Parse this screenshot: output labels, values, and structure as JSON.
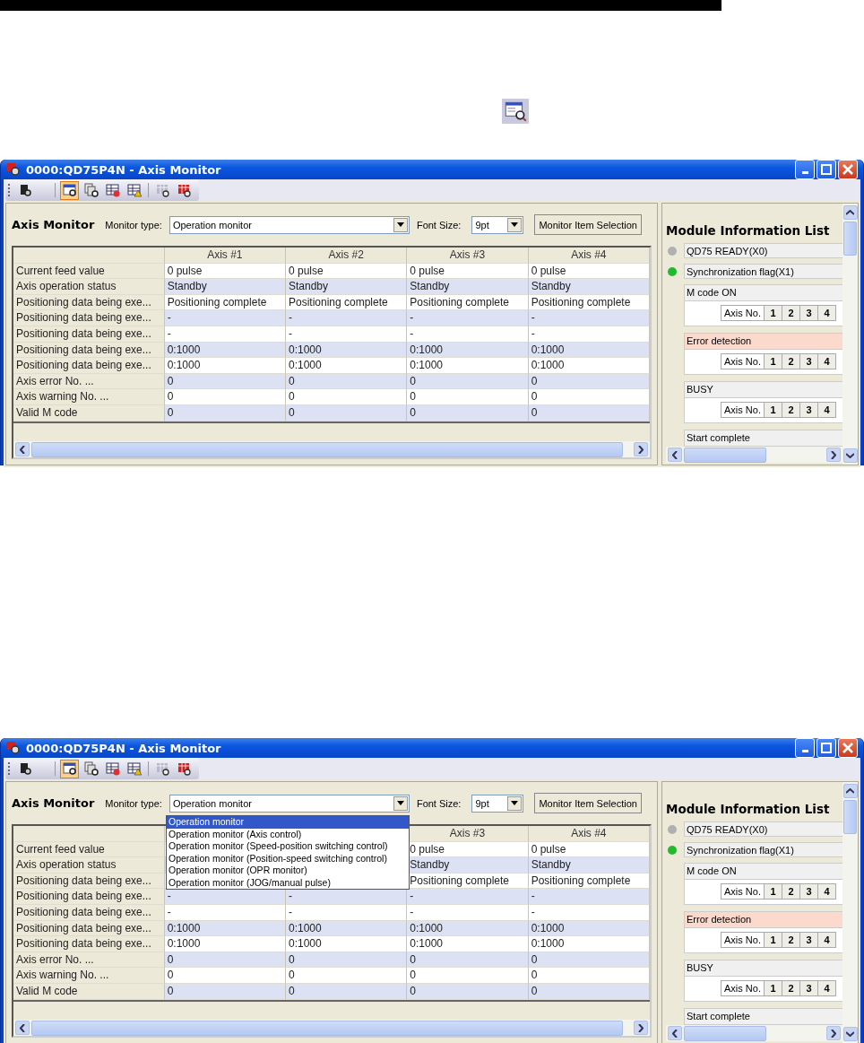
{
  "windows": [
    {
      "title": "0000:QD75P4N - Axis Monitor",
      "toolbar": [
        {
          "selected": false
        },
        {
          "selected": true
        },
        {
          "selected": false
        },
        {
          "selected": false
        },
        {
          "selected": false
        },
        {
          "selected": false
        },
        {
          "selected": false
        }
      ],
      "monitor": {
        "title": "Axis Monitor",
        "type_label": "Monitor type:",
        "type_value": "Operation monitor",
        "font_label": "Font Size:",
        "font_value": "9pt",
        "button": "Monitor Item Selection"
      },
      "table": {
        "columns": [
          "Axis #1",
          "Axis #2",
          "Axis #3",
          "Axis #4"
        ],
        "rows": [
          {
            "label": "Current feed value",
            "cells": [
              "0 pulse",
              "0 pulse",
              "0 pulse",
              "0 pulse"
            ]
          },
          {
            "label": "Axis operation status",
            "cells": [
              "Standby",
              "Standby",
              "Standby",
              "Standby"
            ]
          },
          {
            "label": "Positioning data being exe...",
            "cells": [
              "Positioning complete",
              "Positioning complete",
              "Positioning complete",
              "Positioning complete"
            ]
          },
          {
            "label": "Positioning data being exe...",
            "cells": [
              "-",
              "-",
              "-",
              "-"
            ]
          },
          {
            "label": "Positioning data being exe...",
            "cells": [
              "-",
              "-",
              "-",
              "-"
            ]
          },
          {
            "label": "Positioning data being exe...",
            "cells": [
              "0:1000",
              "0:1000",
              "0:1000",
              "0:1000"
            ]
          },
          {
            "label": "Positioning data being exe...",
            "cells": [
              "0:1000",
              "0:1000",
              "0:1000",
              "0:1000"
            ]
          },
          {
            "label": "Axis error No. ...",
            "cells": [
              "0",
              "0",
              "0",
              "0"
            ]
          },
          {
            "label": "Axis warning No. ...",
            "cells": [
              "0",
              "0",
              "0",
              "0"
            ]
          },
          {
            "label": "Valid M code",
            "cells": [
              "0",
              "0",
              "0",
              "0"
            ]
          }
        ]
      },
      "module_list": {
        "title": "Module Information List",
        "items": [
          {
            "kind": "flag",
            "label": "QD75 READY(X0)",
            "on": false
          },
          {
            "kind": "flag",
            "label": "Synchronization flag(X1)",
            "on": true
          },
          {
            "kind": "axis_group",
            "label": "M code ON",
            "highlighted": false,
            "axis_label": "Axis No.",
            "axes": [
              "1",
              "2",
              "3",
              "4"
            ]
          },
          {
            "kind": "axis_group",
            "label": "Error detection",
            "highlighted": true,
            "axis_label": "Axis No.",
            "axes": [
              "1",
              "2",
              "3",
              "4"
            ]
          },
          {
            "kind": "axis_group",
            "label": "BUSY",
            "highlighted": false,
            "axis_label": "Axis No.",
            "axes": [
              "1",
              "2",
              "3",
              "4"
            ]
          },
          {
            "kind": "header",
            "label": "Start complete",
            "highlighted": false
          }
        ]
      }
    },
    {
      "title": "0000:QD75P4N - Axis Monitor",
      "toolbar": [
        {
          "selected": false
        },
        {
          "selected": true
        },
        {
          "selected": false
        },
        {
          "selected": false
        },
        {
          "selected": false
        },
        {
          "selected": false
        },
        {
          "selected": false
        }
      ],
      "monitor": {
        "title": "Axis Monitor",
        "type_label": "Monitor type:",
        "type_value": "Operation monitor",
        "font_label": "Font Size:",
        "font_value": "9pt",
        "button": "Monitor Item Selection"
      },
      "dropdown": {
        "options": [
          {
            "label": "Operation monitor",
            "selected": true
          },
          {
            "label": "Operation monitor (Axis control)",
            "selected": false
          },
          {
            "label": "Operation monitor (Speed-position switching control)",
            "selected": false
          },
          {
            "label": "Operation monitor (Position-speed switching control)",
            "selected": false
          },
          {
            "label": "Operation monitor (OPR monitor)",
            "selected": false
          },
          {
            "label": "Operation monitor (JOG/manual pulse)",
            "selected": false
          }
        ]
      },
      "table": {
        "columns": [
          null,
          null,
          "Axis #3",
          "Axis #4"
        ],
        "rows": [
          {
            "label": "Current feed value",
            "cells": [
              null,
              null,
              "0 pulse",
              "0 pulse"
            ]
          },
          {
            "label": "Axis operation status",
            "cells": [
              null,
              null,
              "Standby",
              "Standby"
            ]
          },
          {
            "label": "Positioning data being exe...",
            "cells": [
              null,
              null,
              "Positioning complete",
              "Positioning complete"
            ]
          },
          {
            "label": "Positioning data being exe...",
            "cells": [
              "-",
              "-",
              "-",
              "-"
            ]
          },
          {
            "label": "Positioning data being exe...",
            "cells": [
              "-",
              "-",
              "-",
              "-"
            ]
          },
          {
            "label": "Positioning data being exe...",
            "cells": [
              "0:1000",
              "0:1000",
              "0:1000",
              "0:1000"
            ]
          },
          {
            "label": "Positioning data being exe...",
            "cells": [
              "0:1000",
              "0:1000",
              "0:1000",
              "0:1000"
            ]
          },
          {
            "label": "Axis error No. ...",
            "cells": [
              "0",
              "0",
              "0",
              "0"
            ]
          },
          {
            "label": "Axis warning No. ...",
            "cells": [
              "0",
              "0",
              "0",
              "0"
            ]
          },
          {
            "label": "Valid M code",
            "cells": [
              "0",
              "0",
              "0",
              "0"
            ]
          }
        ]
      },
      "module_list": {
        "title": "Module Information List",
        "items": [
          {
            "kind": "flag",
            "label": "QD75 READY(X0)",
            "on": false
          },
          {
            "kind": "flag",
            "label": "Synchronization flag(X1)",
            "on": true
          },
          {
            "kind": "axis_group",
            "label": "M code ON",
            "highlighted": false,
            "axis_label": "Axis No.",
            "axes": [
              "1",
              "2",
              "3",
              "4"
            ]
          },
          {
            "kind": "axis_group",
            "label": "Error detection",
            "highlighted": true,
            "axis_label": "Axis No.",
            "axes": [
              "1",
              "2",
              "3",
              "4"
            ]
          },
          {
            "kind": "axis_group",
            "label": "BUSY",
            "highlighted": false,
            "axis_label": "Axis No.",
            "axes": [
              "1",
              "2",
              "3",
              "4"
            ]
          },
          {
            "kind": "header",
            "label": "Start complete",
            "highlighted": false
          }
        ]
      }
    }
  ]
}
